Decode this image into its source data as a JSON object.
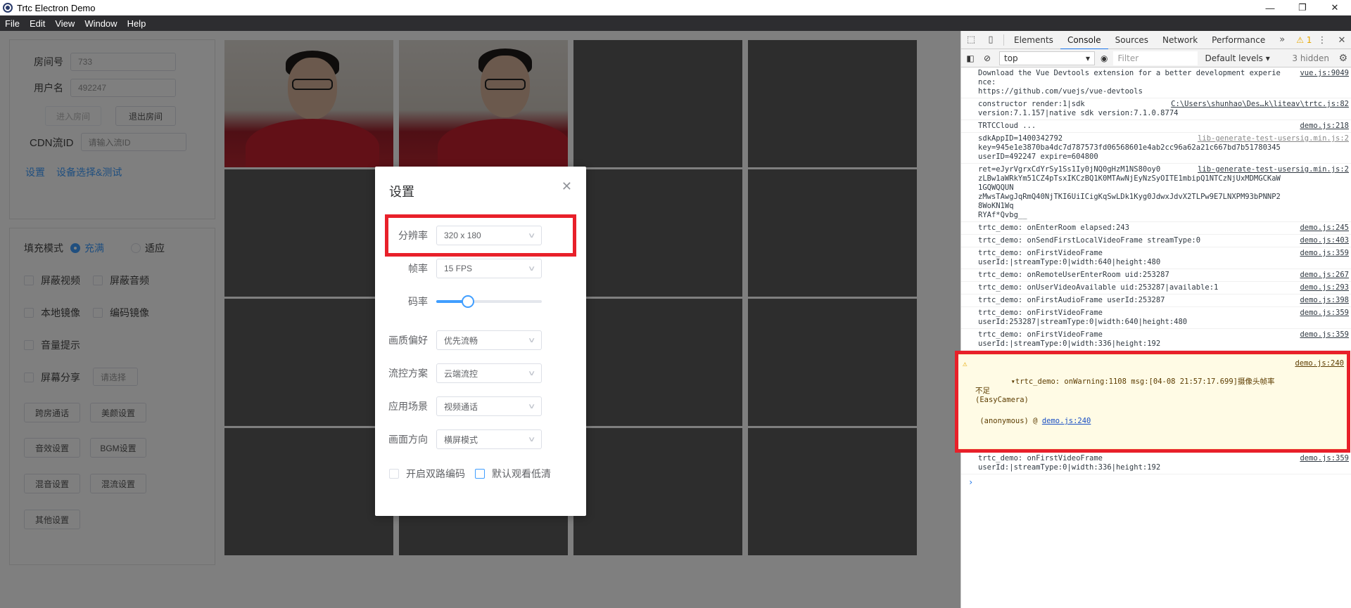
{
  "window": {
    "title": "Trtc Electron Demo",
    "controls": [
      "—",
      "❐",
      "✕"
    ]
  },
  "menubar": [
    "File",
    "Edit",
    "View",
    "Window",
    "Help"
  ],
  "room": {
    "room_label": "房间号",
    "room_value": "733",
    "user_label": "用户名",
    "user_value": "492247",
    "enter_button": "进入房间",
    "exit_button": "退出房间",
    "cdn_label": "CDN流ID",
    "cdn_placeholder": "请输入流ID",
    "settings_link": "设置",
    "device_link": "设备选择&测试"
  },
  "options": {
    "fill_mode_label": "填充模式",
    "fill_option": "充满",
    "fit_option": "适应",
    "mask_video": "屏蔽视频",
    "mask_audio": "屏蔽音频",
    "local_mirror": "本地镜像",
    "encode_mirror": "编码镜像",
    "volume_tip": "音量提示",
    "screen_share": "屏幕分享",
    "screen_select": "请选择",
    "buttons": [
      "跨房通话",
      "美颜设置",
      "音效设置",
      "BGM设置",
      "混音设置",
      "混流设置",
      "其他设置"
    ]
  },
  "dialog": {
    "title": "设置",
    "resolution_label": "分辨率",
    "resolution_value": "320 x 180",
    "fps_label": "帧率",
    "fps_value": "15 FPS",
    "bitrate_label": "码率",
    "bitrate_level": 0.3,
    "quality_label": "画质偏好",
    "quality_value": "优先流畅",
    "flow_label": "流控方案",
    "flow_value": "云端流控",
    "scene_label": "应用场景",
    "scene_value": "视频通话",
    "orientation_label": "画面方向",
    "orientation_value": "横屏模式",
    "dual_stream": "开启双路编码",
    "watch_low": "默认观看低清"
  },
  "devtools": {
    "tabs": [
      "Elements",
      "Console",
      "Sources",
      "Network",
      "Performance"
    ],
    "active_tab": "Console",
    "warning_count": "1",
    "context": "top",
    "filter_placeholder": "Filter",
    "levels": "Default levels ▾",
    "hidden": "3 hidden",
    "logs": [
      {
        "text": "Download the Vue Devtools extension for a better development experience:\nhttps://github.com/vuejs/vue-devtools",
        "src": "vue.js:9049"
      },
      {
        "text": "constructor render:1|sdk\nversion:7.1.157|native sdk version:7.1.0.8774",
        "src": "C:\\Users\\shunhao\\Des…k\\liteav\\trtc.js:82"
      },
      {
        "text": "TRTCCloud ...",
        "src": "demo.js:218"
      },
      {
        "text": "sdkAppID=1400342792\nkey=945e1e3870ba4dc7d787573fd06568601e4ab2cc96a62a21c667bd7b51780345\nuserID=492247 expire=604800",
        "src": "lib-generate-test-usersig.min.js:2"
      },
      {
        "text": "ret=eJyrVgrxCdYrSy1Ss1Iy0jNQ0gHzM1NS80oy0\nzLBw1aWRkYm51CZ4pTsxIKCzBQ1K0MTAwNjEyNzSyOITE1mbipQ1NTCzNjUxMDMGCKaW1GQWQQUN\nzMwsTAwgJqRmQ40NjTKI6UiICigKqSwLDk1Kyg0JdwxJdvX2TLPw9E7LNXPM93bPNNP28WoKN1Wq\nRYAf*Qvbg__",
        "src": "lib-generate-test-usersig.min.js:2"
      },
      {
        "text": "trtc_demo: onEnterRoom elapsed:243",
        "src": "demo.js:245"
      },
      {
        "text": "trtc_demo: onSendFirstLocalVideoFrame streamType:0",
        "src": "demo.js:403"
      },
      {
        "text": "trtc_demo: onFirstVideoFrame\nuserId:|streamType:0|width:640|height:480",
        "src": "demo.js:359"
      },
      {
        "text": "trtc_demo: onRemoteUserEnterRoom uid:253287",
        "src": "demo.js:267"
      },
      {
        "text": "trtc_demo: onUserVideoAvailable uid:253287|available:1",
        "src": "demo.js:293"
      },
      {
        "text": "trtc_demo: onFirstAudioFrame userId:253287",
        "src": "demo.js:398"
      },
      {
        "text": "trtc_demo: onFirstVideoFrame\nuserId:253287|streamType:0|width:640|height:480",
        "src": "demo.js:359"
      },
      {
        "text": "trtc_demo: onFirstVideoFrame\nuserId:|streamType:0|width:336|height:192",
        "src": "demo.js:359"
      }
    ],
    "warning": {
      "text": "▾trtc_demo: onWarning:1108 msg:[04-08 21:57:17.699]摄像头帧率不足\n(EasyCamera)",
      "src": "demo.js:240",
      "sub_prefix": "(anonymous) @",
      "sub_link": "demo.js:240"
    },
    "last_log": {
      "text": "trtc_demo: onFirstVideoFrame\nuserId:|streamType:0|width:336|height:192",
      "src": "demo.js:359"
    },
    "prompt": "›"
  },
  "colors": {
    "accent": "#409eff",
    "highlight": "#e8202a",
    "overlay": "rgba(0,0,0,0.5)"
  }
}
